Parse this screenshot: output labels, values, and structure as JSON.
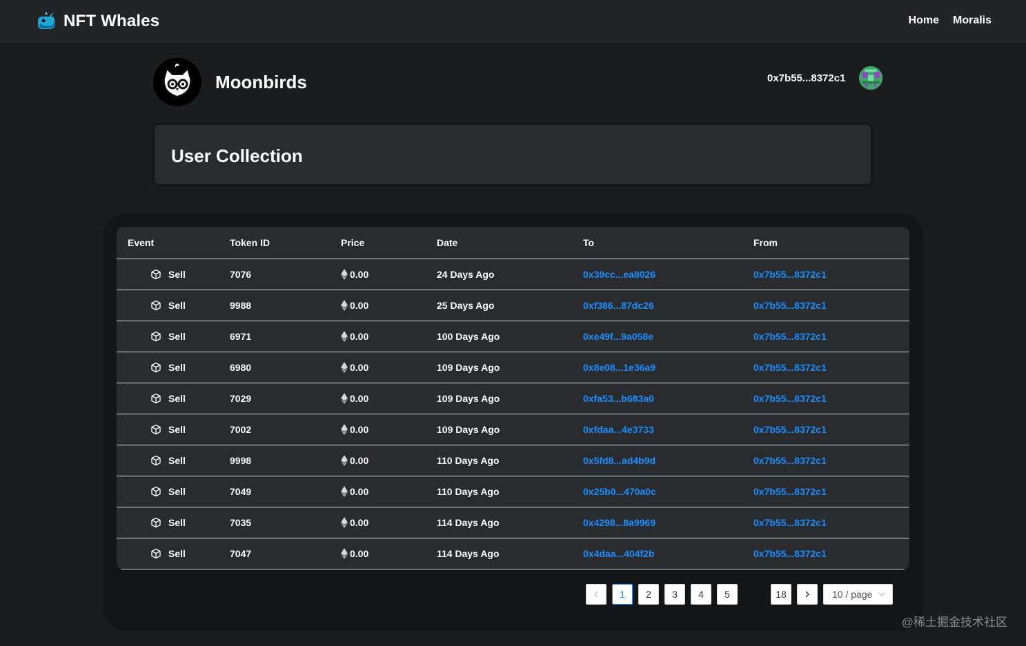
{
  "app": {
    "title": "NFT Whales",
    "nav": [
      "Home",
      "Moralis"
    ]
  },
  "collection": {
    "name": "Moonbirds"
  },
  "wallet": {
    "address": "0x7b55...8372c1"
  },
  "section": {
    "title": "User Collection"
  },
  "table": {
    "columns": [
      "Event",
      "Token ID",
      "Price",
      "Date",
      "To",
      "From"
    ],
    "rows": [
      {
        "event": "Sell",
        "token_id": "7076",
        "price": "0.00",
        "date": "24 Days Ago",
        "to": "0x39cc...ea8026",
        "from": "0x7b55...8372c1"
      },
      {
        "event": "Sell",
        "token_id": "9988",
        "price": "0.00",
        "date": "25 Days Ago",
        "to": "0xf386...87dc26",
        "from": "0x7b55...8372c1"
      },
      {
        "event": "Sell",
        "token_id": "6971",
        "price": "0.00",
        "date": "100 Days Ago",
        "to": "0xe49f...9a058e",
        "from": "0x7b55...8372c1"
      },
      {
        "event": "Sell",
        "token_id": "6980",
        "price": "0.00",
        "date": "109 Days Ago",
        "to": "0x8e08...1e36a9",
        "from": "0x7b55...8372c1"
      },
      {
        "event": "Sell",
        "token_id": "7029",
        "price": "0.00",
        "date": "109 Days Ago",
        "to": "0xfa53...b683a0",
        "from": "0x7b55...8372c1"
      },
      {
        "event": "Sell",
        "token_id": "7002",
        "price": "0.00",
        "date": "109 Days Ago",
        "to": "0xfdaa...4e3733",
        "from": "0x7b55...8372c1"
      },
      {
        "event": "Sell",
        "token_id": "9998",
        "price": "0.00",
        "date": "110 Days Ago",
        "to": "0x5fd8...ad4b9d",
        "from": "0x7b55...8372c1"
      },
      {
        "event": "Sell",
        "token_id": "7049",
        "price": "0.00",
        "date": "110 Days Ago",
        "to": "0x25b0...470a0c",
        "from": "0x7b55...8372c1"
      },
      {
        "event": "Sell",
        "token_id": "7035",
        "price": "0.00",
        "date": "114 Days Ago",
        "to": "0x4298...8a9969",
        "from": "0x7b55...8372c1"
      },
      {
        "event": "Sell",
        "token_id": "7047",
        "price": "0.00",
        "date": "114 Days Ago",
        "to": "0x4daa...404f2b",
        "from": "0x7b55...8372c1"
      }
    ]
  },
  "pagination": {
    "pages": [
      "1",
      "2",
      "3",
      "4",
      "5"
    ],
    "last_page": "18",
    "current": "1",
    "page_size": "10 / page"
  },
  "watermark": "@稀土掘金技术社区",
  "colors": {
    "background": "#1b1c1e",
    "navbar": "#232426",
    "card": "#2a2b2e",
    "link": "#1890ff"
  }
}
